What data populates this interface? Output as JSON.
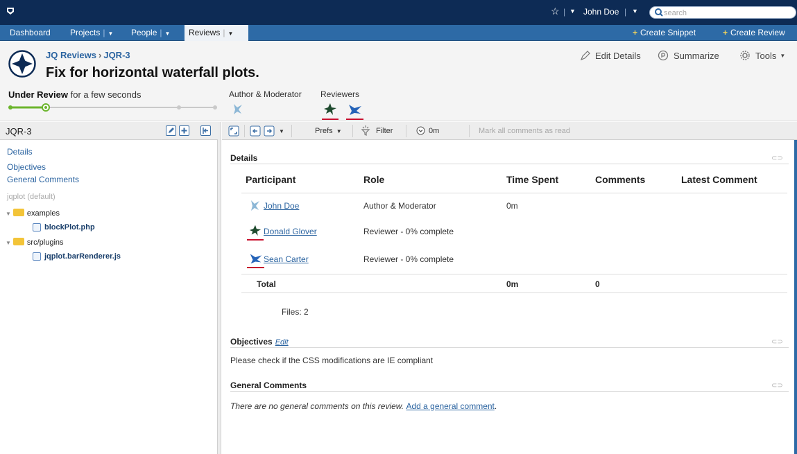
{
  "topbar": {
    "user": "John Doe",
    "search_placeholder": "search",
    "colors": {
      "bar": "#0d2b55",
      "nav": "#2d6aa6"
    }
  },
  "nav": {
    "items": [
      {
        "label": "Dashboard"
      },
      {
        "label": "Projects"
      },
      {
        "label": "People"
      },
      {
        "label": "Reviews"
      }
    ],
    "create_snippet": "Create Snippet",
    "create_review": "Create Review"
  },
  "header": {
    "breadcrumb_project": "JQ Reviews",
    "breadcrumb_review": "JQR-3",
    "title": "Fix for horizontal waterfall plots.",
    "edit_details": "Edit Details",
    "summarize": "Summarize",
    "tools": "Tools",
    "status_label": "Under Review",
    "status_time": "for a few seconds",
    "author_moderator_label": "Author & Moderator",
    "reviewers_label": "Reviewers"
  },
  "left": {
    "title": "JQR-3",
    "links": [
      "Details",
      "Objectives",
      "General Comments"
    ],
    "repo": "jqplot (default)",
    "tree": [
      {
        "folder": "examples",
        "file": "blockPlot.php"
      },
      {
        "folder": "src/plugins",
        "file": "jqplot.barRenderer.js"
      }
    ]
  },
  "toolbar": {
    "prefs": "Prefs",
    "filter": "Filter",
    "time": "0m",
    "mark_read": "Mark all comments as read"
  },
  "details": {
    "title": "Details",
    "headers": [
      "Participant",
      "Role",
      "Time Spent",
      "Comments",
      "Latest Comment"
    ],
    "rows": [
      {
        "name": "John Doe",
        "role": "Author & Moderator",
        "time": "0m"
      },
      {
        "name": "Donald Glover",
        "role": "Reviewer - 0% complete",
        "time": ""
      },
      {
        "name": "Sean Carter",
        "role": "Reviewer - 0% complete",
        "time": ""
      }
    ],
    "total_label": "Total",
    "total_time": "0m",
    "total_comments": "0",
    "files": "Files: 2"
  },
  "objectives": {
    "title": "Objectives",
    "edit": "Edit",
    "text": "Please check if the CSS modifications are IE compliant"
  },
  "general": {
    "title": "General Comments",
    "text": "There are no general comments on this review.",
    "link": "Add a general comment",
    "end": "."
  }
}
